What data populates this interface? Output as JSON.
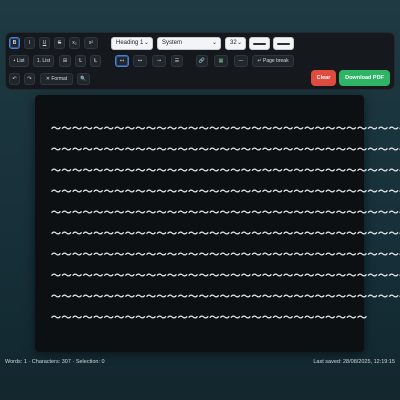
{
  "toolbar": {
    "bold": "B",
    "italic": "I",
    "underline": "U",
    "strikethrough": "S",
    "subscript": "x₂",
    "superscript": "x²",
    "heading_select": "Heading 1",
    "font_select": "System",
    "size_select": "32",
    "bullet_list": "• List",
    "numbered_list": "1. List",
    "table": "⊞",
    "align_left_tool": "Ƚ",
    "align_right_tool": "Ɫ",
    "indent_active": "↤",
    "direction_ltr": "↔",
    "arrow_right": "→",
    "justify": "☰",
    "link": "🔗",
    "image": "▦",
    "hr": "—",
    "page_break": "↵ Page break",
    "undo": "↶",
    "redo": "↷",
    "clear_format": "✕ Format",
    "search": "🔍",
    "clear": "Clear",
    "download_pdf": "Download PDF"
  },
  "editor": {
    "lines": [
      "〜〜〜〜〜〜〜〜〜〜〜〜〜〜〜〜〜〜〜〜〜〜〜〜〜〜〜〜〜〜〜〜〜〜",
      "〜〜〜〜〜〜〜〜〜〜〜〜〜〜〜〜〜〜〜〜〜〜〜〜〜〜〜〜〜〜〜〜〜〜",
      "〜〜〜〜〜〜〜〜〜〜〜〜〜〜〜〜〜〜〜〜〜〜〜〜〜〜〜〜〜〜〜〜〜〜",
      "〜〜〜〜〜〜〜〜〜〜〜〜〜〜〜〜〜〜〜〜〜〜〜〜〜〜〜〜〜〜〜〜〜〜",
      "〜〜〜〜〜〜〜〜〜〜〜〜〜〜〜〜〜〜〜〜〜〜〜〜〜〜〜〜〜〜〜〜〜〜",
      "〜〜〜〜〜〜〜〜〜〜〜〜〜〜〜〜〜〜〜〜〜〜〜〜〜〜〜〜〜〜〜〜〜〜",
      "〜〜〜〜〜〜〜〜〜〜〜〜〜〜〜〜〜〜〜〜〜〜〜〜〜〜〜〜〜〜〜〜〜〜",
      "〜〜〜〜〜〜〜〜〜〜〜〜〜〜〜〜〜〜〜〜〜〜〜〜〜〜〜〜〜〜〜〜〜〜",
      "〜〜〜〜〜〜〜〜〜〜〜〜〜〜〜〜〜〜〜〜〜〜〜〜〜〜〜〜〜〜〜〜〜〜",
      "〜〜〜〜〜〜〜〜〜〜〜〜〜〜〜〜〜〜〜〜〜〜〜〜〜〜〜〜〜〜"
    ]
  },
  "status": {
    "left": "Words: 1 · Characters: 307 · Selection: 0",
    "right": "Last saved: 28/08/2025, 12:19:15"
  },
  "colors": {
    "accent": "#4b7fd0",
    "clear": "#e04b40",
    "download": "#2fb466",
    "editor_bg": "#0d1013"
  },
  "icons": {
    "link": "link-icon",
    "image": "image-icon",
    "search": "search-icon",
    "undo": "undo-icon",
    "redo": "redo-icon"
  }
}
